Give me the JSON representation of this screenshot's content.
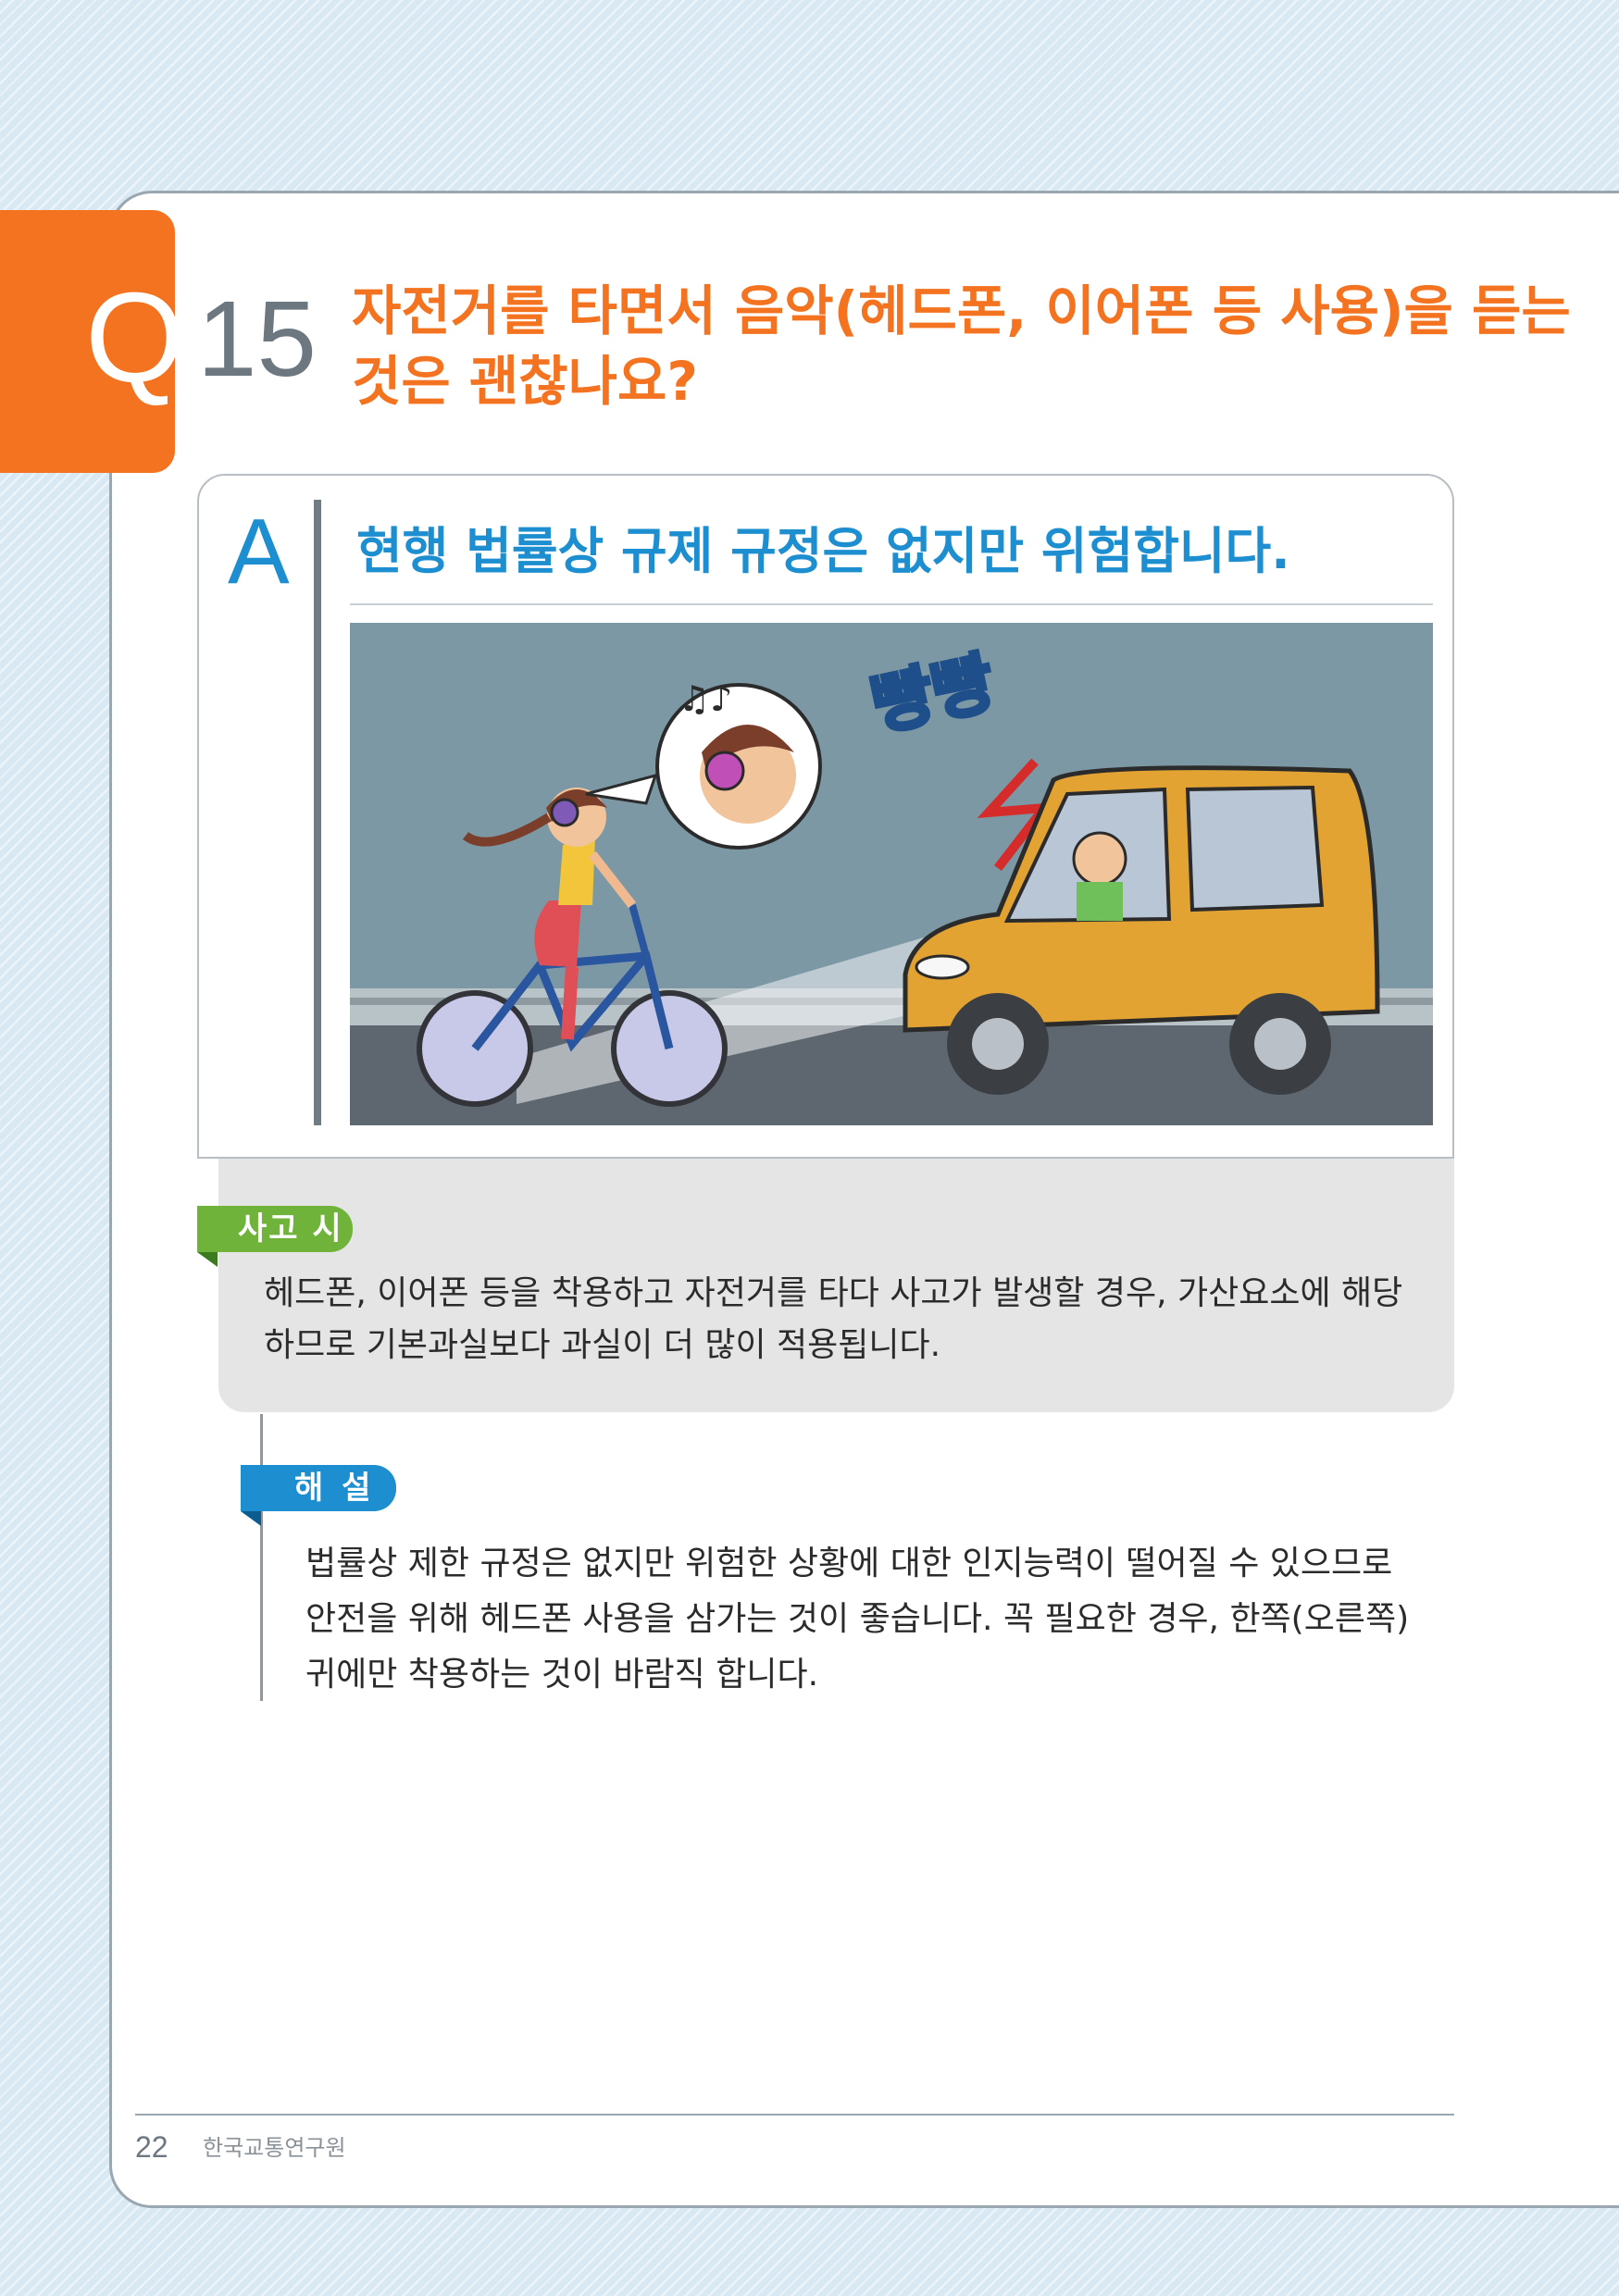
{
  "question": {
    "letter": "Q",
    "number": "15",
    "title_lines": [
      "자전거를 타면서 음악(헤드폰, 이어폰 등 사용)을 듣는",
      "것은 괜찮나요?"
    ]
  },
  "answer": {
    "letter": "A",
    "title": "현행 법률상 규제 규정은 없지만 위험합니다."
  },
  "illustration": {
    "sound_text": "빵빵"
  },
  "accident": {
    "label": "사고 시",
    "lines": [
      "헤드폰, 이어폰 등을 착용하고 자전거를 타다 사고가 발생할 경우, 가산요소에 해당",
      "하므로 기본과실보다 과실이 더 많이 적용됩니다."
    ]
  },
  "explanation": {
    "label": "해 설",
    "lines": [
      "법률상 제한 규정은 없지만 위험한 상황에 대한 인지능력이 떨어질 수 있으므로",
      "안전을 위해 헤드폰 사용을 삼가는 것이 좋습니다. 꼭 필요한 경우, 한쪽(오른쪽)",
      "귀에만 착용하는 것이 바람직 합니다."
    ]
  },
  "footer": {
    "page_number": "22",
    "organization": "한국교통연구원"
  },
  "colors": {
    "orange": "#f47320",
    "blue": "#1d8ecf",
    "green": "#6fb33b",
    "sky": "#7c98a4",
    "car": "#e2a332"
  }
}
